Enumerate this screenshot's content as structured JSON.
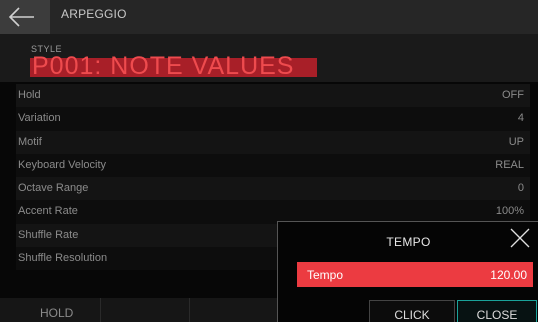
{
  "header": {
    "title": "ARPEGGIO"
  },
  "style": {
    "label": "STYLE",
    "value": "P001: NOTE VALUES"
  },
  "params": [
    {
      "label": "Hold",
      "value": "OFF"
    },
    {
      "label": "Variation",
      "value": "4"
    },
    {
      "label": "Motif",
      "value": "UP"
    },
    {
      "label": "Keyboard Velocity",
      "value": "REAL"
    },
    {
      "label": "Octave Range",
      "value": "0"
    },
    {
      "label": "Accent Rate",
      "value": "100%"
    },
    {
      "label": "Shuffle Rate",
      "value": ""
    },
    {
      "label": "Shuffle Resolution",
      "value": ""
    }
  ],
  "softkeys": {
    "hold_label": "HOLD"
  },
  "dialog": {
    "title": "TEMPO",
    "field_label": "Tempo",
    "field_value": "120.00",
    "click_label": "CLICK",
    "close_label": "CLOSE"
  },
  "colors": {
    "accent_red": "#ec3b41",
    "style_red": "#a81f28",
    "close_border": "#1aa39a"
  },
  "icons": {
    "back": "arrow-left-icon",
    "dialog_close": "close-x-icon"
  }
}
